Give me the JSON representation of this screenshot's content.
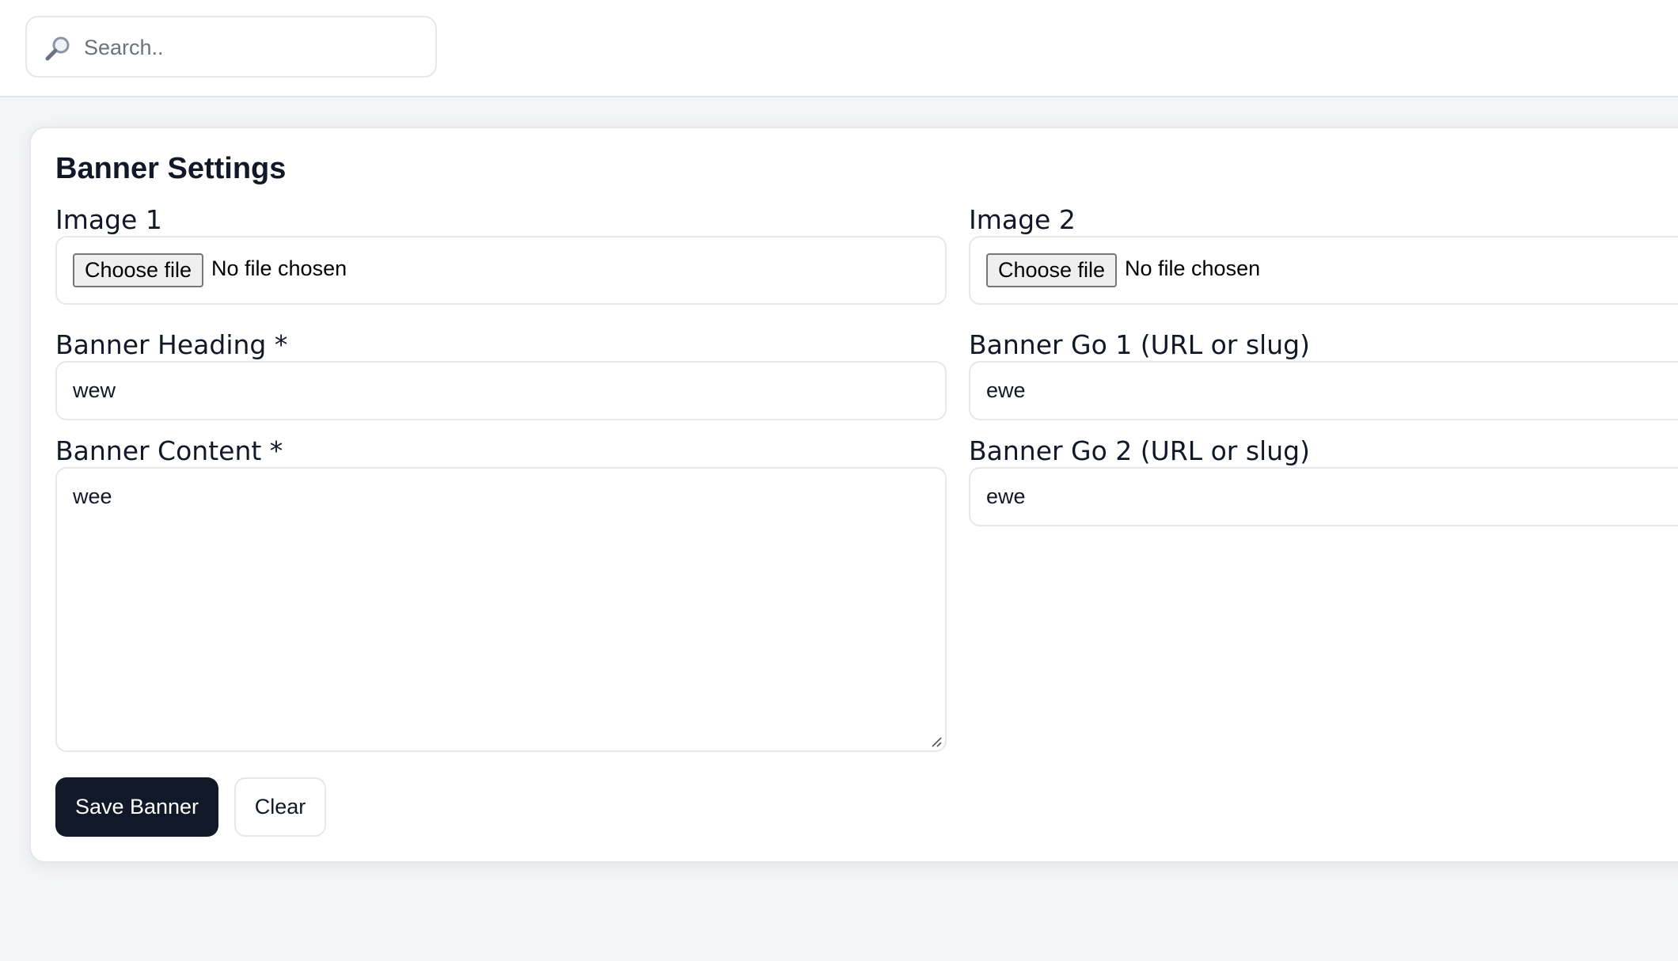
{
  "search": {
    "placeholder": "Search.."
  },
  "card": {
    "title": "Banner Settings",
    "image1": {
      "label": "Image 1",
      "button": "Choose file",
      "status": "No file chosen"
    },
    "image2": {
      "label": "Image 2",
      "button": "Choose file",
      "status": "No file chosen"
    },
    "heading": {
      "label": "Banner Heading *",
      "value": "wew"
    },
    "go1": {
      "label": "Banner Go 1 (URL or slug)",
      "value": "ewe"
    },
    "content": {
      "label": "Banner Content *",
      "value": "wee"
    },
    "go2": {
      "label": "Banner Go 2 (URL or slug)",
      "value": "ewe"
    },
    "actions": {
      "save": "Save Banner",
      "clear": "Clear"
    }
  },
  "colors": {
    "primary": "#111827",
    "border": "#e5e7eb",
    "background": "#f4f5f8"
  }
}
